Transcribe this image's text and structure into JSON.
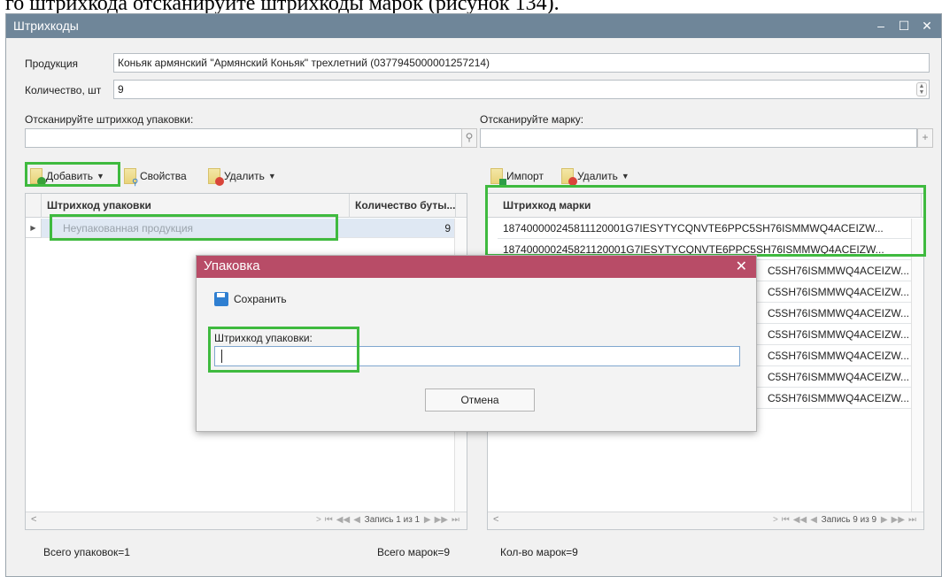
{
  "caption": "го штрихкода отсканируйте штрихкоды марок (рисунок 134).",
  "window": {
    "title": "Штрихкоды",
    "controls": {
      "minimize": "–",
      "maximize": "☐",
      "close": "✕"
    }
  },
  "form": {
    "product_label": "Продукция",
    "product_value": "Коньяк армянский \"Армянский Коньяк\" трехлетний (0377945000001257214)",
    "quantity_label": "Количество, шт",
    "quantity_value": "9",
    "scan_package_label": "Отсканируйте штрихкод упаковки:",
    "scan_mark_label": "Отсканируйте марку:"
  },
  "left_toolbar": {
    "add": "Добавить",
    "properties": "Свойства",
    "delete": "Удалить"
  },
  "right_toolbar": {
    "import": "Импорт",
    "delete": "Удалить"
  },
  "left_grid": {
    "columns": [
      "Штрихкод упаковки",
      "Количество буты..."
    ],
    "rows": [
      {
        "barcode": "Неупакованная продукция",
        "count": "9"
      }
    ],
    "nav": "Запись 1 из 1"
  },
  "right_grid": {
    "columns": [
      "Штрихкод марки"
    ],
    "rows": [
      "187400000245811120001G7IESYTYCQNVTE6PPC5SH76ISMMWQ4ACEIZW...",
      "187400000245821120001G7IESYTYCQNVTE6PPC5SH76ISMMWQ4ACEIZW...",
      "C5SH76ISMMWQ4ACEIZW...",
      "C5SH76ISMMWQ4ACEIZW...",
      "C5SH76ISMMWQ4ACEIZW...",
      "C5SH76ISMMWQ4ACEIZW...",
      "C5SH76ISMMWQ4ACEIZW...",
      "C5SH76ISMMWQ4ACEIZW...",
      "C5SH76ISMMWQ4ACEIZW..."
    ],
    "nav": "Запись 9 из 9"
  },
  "status": {
    "total_packages": "Всего упаковок=1",
    "total_marks": "Всего марок=9",
    "marks_count": "Кол-во марок=9"
  },
  "dialog": {
    "title": "Упаковка",
    "close": "✕",
    "save": "Сохранить",
    "field_label": "Штрихкод упаковки:",
    "field_value": "",
    "cancel": "Отмена"
  },
  "colors": {
    "highlight": "#3fba3f",
    "titlebar": "#6f8699",
    "dialog_title": "#b84c67"
  }
}
